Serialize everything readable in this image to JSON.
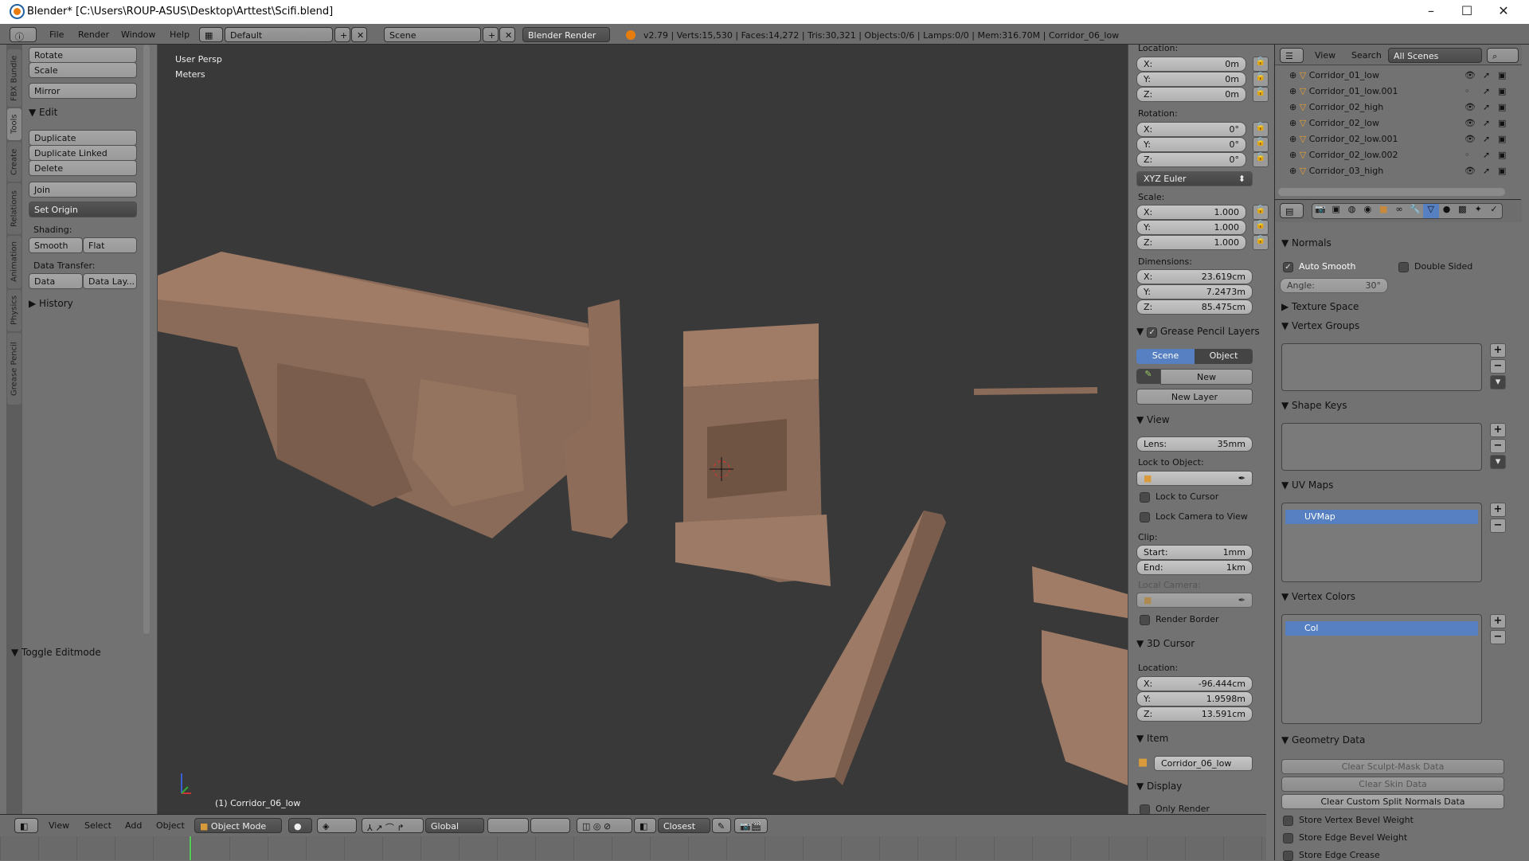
{
  "window": {
    "title": "Blender* [C:\\Users\\ROUP-ASUS\\Desktop\\Arttest\\Scifi.blend]",
    "minimize": "–",
    "maximize": "☐",
    "close": "✕"
  },
  "topbar": {
    "menus": [
      "File",
      "Render",
      "Window",
      "Help"
    ],
    "layout": "Default",
    "scene": "Scene",
    "engine": "Blender Render",
    "stats": "v2.79 | Verts:15,530 | Faces:14,272 | Tris:30,321 | Objects:0/6 | Lamps:0/0 | Mem:316.70M | Corridor_06_low"
  },
  "tabs": [
    "FBX Bundle",
    "Tools",
    "Create",
    "Relations",
    "Animation",
    "Physics",
    "Grease Pencil"
  ],
  "shelf": {
    "rotate": "Rotate",
    "scale": "Scale",
    "mirror": "Mirror",
    "edit": "Edit",
    "duplicate": "Duplicate",
    "duplicate_linked": "Duplicate Linked",
    "delete": "Delete",
    "join": "Join",
    "set_origin": "Set Origin",
    "shading": "Shading:",
    "smooth": "Smooth",
    "flat": "Flat",
    "data_transfer": "Data Transfer:",
    "data": "Data",
    "data_layout": "Data Lay...",
    "history": "History",
    "toggle_editmode": "Toggle Editmode"
  },
  "viewport": {
    "view_name": "User Persp",
    "units": "Meters",
    "active_object": "(1) Corridor_06_low"
  },
  "npanel": {
    "location_label": "Location:",
    "location": {
      "x": "0m",
      "y": "0m",
      "z": "0m"
    },
    "rotation_label": "Rotation:",
    "rotation": {
      "x": "0°",
      "y": "0°",
      "z": "0°"
    },
    "rotation_mode": "XYZ Euler",
    "scale_label": "Scale:",
    "scale": {
      "x": "1.000",
      "y": "1.000",
      "z": "1.000"
    },
    "dimensions_label": "Dimensions:",
    "dimensions": {
      "x": "23.619cm",
      "y": "7.2473m",
      "z": "85.475cm"
    },
    "axis": {
      "x": "X:",
      "y": "Y:",
      "z": "Z:"
    },
    "grease_pencil": "Grease Pencil Layers",
    "gp_scene": "Scene",
    "gp_object": "Object",
    "gp_new": "New",
    "gp_new_layer": "New Layer",
    "view": "View",
    "lens_label": "Lens:",
    "lens": "35mm",
    "lock_to_object": "Lock to Object:",
    "lock_to_cursor": "Lock to Cursor",
    "lock_camera": "Lock Camera to View",
    "clip": "Clip:",
    "start_label": "Start:",
    "start": "1mm",
    "end_label": "End:",
    "end": "1km",
    "local_camera": "Local Camera:",
    "render_border": "Render Border",
    "cursor": "3D Cursor",
    "cursor_location": "Location:",
    "cursor_xyz": {
      "x": "-96.444cm",
      "y": "1.9598m",
      "z": "13.591cm"
    },
    "item": "Item",
    "item_name": "Corridor_06_low",
    "display": "Display",
    "only_render": "Only Render"
  },
  "outliner": {
    "view": "View",
    "search": "Search",
    "scenes": "All Scenes",
    "rows": [
      {
        "name": "Corridor_01_low",
        "visible": true
      },
      {
        "name": "Corridor_01_low.001",
        "visible": false
      },
      {
        "name": "Corridor_02_high",
        "visible": true
      },
      {
        "name": "Corridor_02_low",
        "visible": true
      },
      {
        "name": "Corridor_02_low.001",
        "visible": true
      },
      {
        "name": "Corridor_02_low.002",
        "visible": false
      },
      {
        "name": "Corridor_03_high",
        "visible": true
      }
    ]
  },
  "props": {
    "normals": "Normals",
    "auto_smooth": "Auto Smooth",
    "double_sided": "Double Sided",
    "angle_label": "Angle:",
    "angle": "30°",
    "texture_space": "Texture Space",
    "vertex_groups": "Vertex Groups",
    "shape_keys": "Shape Keys",
    "uv_maps": "UV Maps",
    "uv_map": "UVMap",
    "vertex_colors": "Vertex Colors",
    "vcol": "Col",
    "geometry_data": "Geometry Data",
    "clear_sculpt": "Clear Sculpt-Mask Data",
    "clear_skin": "Clear Skin Data",
    "clear_split": "Clear Custom Split Normals Data",
    "store_vertex_bevel": "Store Vertex Bevel Weight",
    "store_edge_bevel": "Store Edge Bevel Weight",
    "store_edge_crease": "Store Edge Crease"
  },
  "bottom": {
    "view": "View",
    "select": "Select",
    "add": "Add",
    "object": "Object",
    "mode": "Object Mode",
    "orientation": "Global",
    "snap": "Closest"
  },
  "colors": {
    "accent": "#5680c2",
    "viewport": "#393939",
    "panel": "#727272",
    "model": "#8a6a58"
  }
}
